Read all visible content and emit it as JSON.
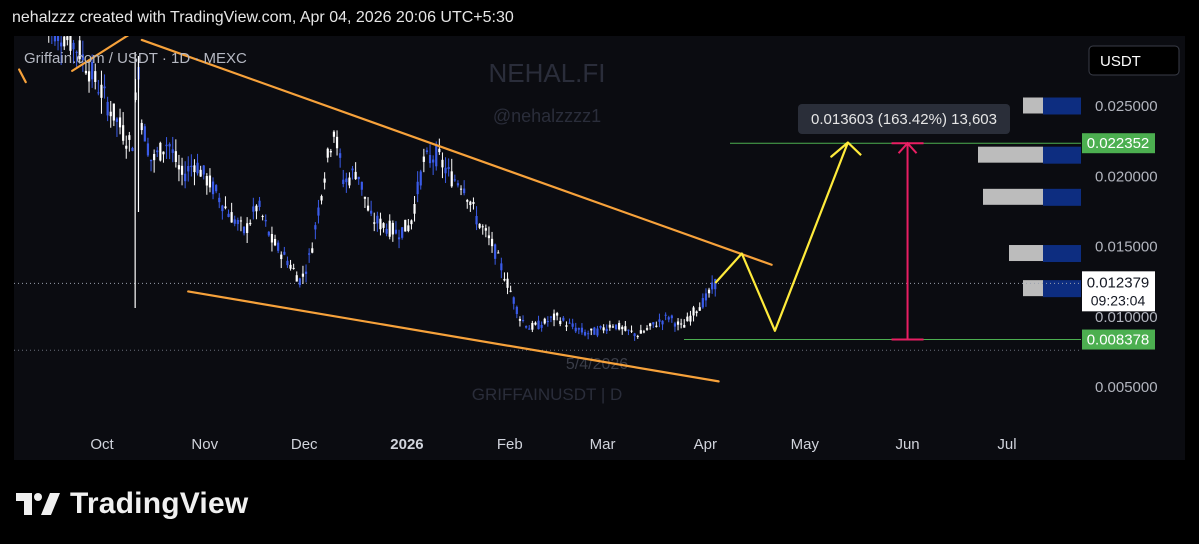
{
  "snapshot_caption": "nehalzzz created with TradingView.com, Apr 04, 2026 20:06 UTC+5:30",
  "symbol_title": "Griffain.com / USDT · 1D · MEXC",
  "watermark_brand": "NEHAL.FI",
  "watermark_handle": "@nehalzzzz1",
  "watermark_symbol": "GRIFFAINUSDT | D",
  "currency_label": "USDT",
  "brand_name": "TradingView",
  "colors": {
    "background": "#0b0c11",
    "candle_up": "#ffffff",
    "candle_down": "#3a5be8",
    "trendline": "#f7a23b",
    "projection": "#ffeb3b",
    "measure": "#e91e63",
    "level_line": "#4caf50",
    "green_badge": "#4caf50"
  },
  "chart_data": {
    "type": "candlestick",
    "title": "Griffain.com / USDT · 1D · MEXC",
    "y_axis": {
      "range": [
        0.0025,
        0.0305
      ],
      "ticks": [
        "0.025000",
        "0.020000",
        "0.015000",
        "0.010000",
        "0.005000"
      ],
      "tick_values": [
        0.025,
        0.02,
        0.015,
        0.01,
        0.005
      ]
    },
    "x_axis": {
      "labels": [
        {
          "text": "Oct",
          "date": "2025-10-01",
          "bold": false
        },
        {
          "text": "Nov",
          "date": "2025-11-01",
          "bold": false
        },
        {
          "text": "Dec",
          "date": "2025-12-01",
          "bold": false
        },
        {
          "text": "2026",
          "date": "2026-01-01",
          "bold": true
        },
        {
          "text": "Feb",
          "date": "2026-02-01",
          "bold": false
        },
        {
          "text": "Mar",
          "date": "2026-03-01",
          "bold": false
        },
        {
          "text": "Apr",
          "date": "2026-04-01",
          "bold": false
        },
        {
          "text": "May",
          "date": "2026-05-01",
          "bold": false
        },
        {
          "text": "Jun",
          "date": "2026-06-01",
          "bold": false
        },
        {
          "text": "Jul",
          "date": "2026-07-01",
          "bold": false
        }
      ]
    },
    "price_path": [
      [
        "2025-09-14",
        0.031
      ],
      [
        "2025-09-20",
        0.03
      ],
      [
        "2025-09-24",
        0.029
      ],
      [
        "2025-10-10",
        0.022
      ],
      [
        "2025-10-12",
        0.028
      ],
      [
        "2025-10-13",
        0.024
      ],
      [
        "2025-10-16",
        0.021
      ],
      [
        "2025-10-21",
        0.0225
      ],
      [
        "2025-10-25",
        0.02
      ],
      [
        "2025-10-29",
        0.021
      ],
      [
        "2025-11-04",
        0.019
      ],
      [
        "2025-11-08",
        0.0175
      ],
      [
        "2025-11-13",
        0.016
      ],
      [
        "2025-11-17",
        0.018
      ],
      [
        "2025-11-21",
        0.0155
      ],
      [
        "2025-11-26",
        0.014
      ],
      [
        "2025-11-30",
        0.0125
      ],
      [
        "2025-12-03",
        0.0145
      ],
      [
        "2025-12-07",
        0.02
      ],
      [
        "2025-12-10",
        0.0235
      ],
      [
        "2025-12-13",
        0.0195
      ],
      [
        "2025-12-17",
        0.0205
      ],
      [
        "2025-12-21",
        0.017
      ],
      [
        "2025-12-25",
        0.0165
      ],
      [
        "2025-12-29",
        0.016
      ],
      [
        "2026-01-02",
        0.0165
      ],
      [
        "2026-01-06",
        0.021
      ],
      [
        "2026-01-10",
        0.0215
      ],
      [
        "2026-01-14",
        0.02
      ],
      [
        "2026-01-18",
        0.0195
      ],
      [
        "2026-01-22",
        0.017
      ],
      [
        "2026-01-27",
        0.015
      ],
      [
        "2026-02-01",
        0.012
      ],
      [
        "2026-02-04",
        0.01
      ],
      [
        "2026-02-07",
        0.0092
      ],
      [
        "2026-02-11",
        0.0095
      ],
      [
        "2026-02-15",
        0.01
      ],
      [
        "2026-02-19",
        0.0094
      ],
      [
        "2026-02-24",
        0.0088
      ],
      [
        "2026-02-28",
        0.009
      ],
      [
        "2026-03-04",
        0.0095
      ],
      [
        "2026-03-08",
        0.009
      ],
      [
        "2026-03-12",
        0.0087
      ],
      [
        "2026-03-17",
        0.0095
      ],
      [
        "2026-03-21",
        0.01
      ],
      [
        "2026-03-25",
        0.0092
      ],
      [
        "2026-03-29",
        0.0105
      ],
      [
        "2026-04-01",
        0.0112
      ],
      [
        "2026-04-04",
        0.01238
      ]
    ],
    "trendlines": [
      {
        "name": "upper-channel",
        "from": [
          "2025-10-13",
          0.0297
        ],
        "to": [
          "2026-04-21",
          0.0137
        ]
      },
      {
        "name": "lower-channel",
        "from": [
          "2025-10-27",
          0.0118
        ],
        "to": [
          "2026-04-05",
          0.0054
        ]
      },
      {
        "name": "top-left-stub",
        "from": [
          "2025-09-22",
          0.0275
        ],
        "to": [
          "2025-10-12",
          0.0305
        ]
      },
      {
        "name": "left-edge-stub",
        "from": [
          "2025-09-06",
          0.0276
        ],
        "to": [
          "2025-09-08",
          0.0267
        ]
      }
    ],
    "projection_path": [
      [
        "2026-04-04",
        0.0124
      ],
      [
        "2026-04-12",
        0.0145
      ],
      [
        "2026-04-22",
        0.009
      ],
      [
        "2026-05-14",
        0.0224
      ],
      [
        "2026-05-09",
        0.0214
      ],
      [
        "2026-05-14",
        0.0224
      ],
      [
        "2026-05-18",
        0.0215
      ]
    ],
    "levels": [
      {
        "name": "target",
        "value": 0.022352,
        "label": "0.022352"
      },
      {
        "name": "base",
        "value": 0.008378,
        "label": "0.008378"
      }
    ],
    "current_price": {
      "value": 0.012379,
      "label": "0.012379",
      "countdown": "09:23:04"
    },
    "measure": {
      "date": "2026-06-01",
      "from": 0.008378,
      "to": 0.022352,
      "label": "0.013603 (163.42%) 13,603"
    },
    "low_marker": {
      "text": "5/4/2026",
      "date": "2026-03-02",
      "value": 0.00762
    },
    "volume_profile": [
      {
        "price": 0.012,
        "volume": 0.2
      },
      {
        "price": 0.0145,
        "volume": 0.34
      },
      {
        "price": 0.0185,
        "volume": 0.6
      },
      {
        "price": 0.0215,
        "volume": 0.65
      },
      {
        "price": 0.025,
        "volume": 0.2
      }
    ]
  }
}
